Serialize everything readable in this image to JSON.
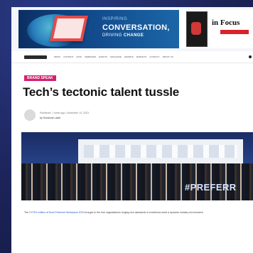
{
  "banner": {
    "kicker": "INSPIRING",
    "headline": "CONVERSATION,",
    "sub_prefix": "DRIVING ",
    "sub_bold": "CHANGE",
    "right_title": "in Focus"
  },
  "nav": {
    "items": [
      "NEWS",
      "CONTENT",
      "DATA",
      "WEBINARS",
      "EVENTS",
      "MAGAZINE",
      "AWARDS",
      "MARKETS",
      "CONTACT",
      "ABOUT US"
    ]
  },
  "article": {
    "category": "BRAND SPEAK",
    "title": "Tech’s tectonic talent tussle",
    "meta_line": "Published: 1 week ago | November 13, 2023",
    "author": "by Someone Lahiri",
    "hero_overlay": "#PREFERR",
    "caption_link_1": "IT/ITES edition",
    "caption_link_2": "Most Preferred Workplace 2023",
    "caption_prefix": "The ",
    "caption_mid": " of ",
    "caption_suffix": " brought to the fore organisations forging new standards of excellence amid a dynamic industry environment."
  }
}
